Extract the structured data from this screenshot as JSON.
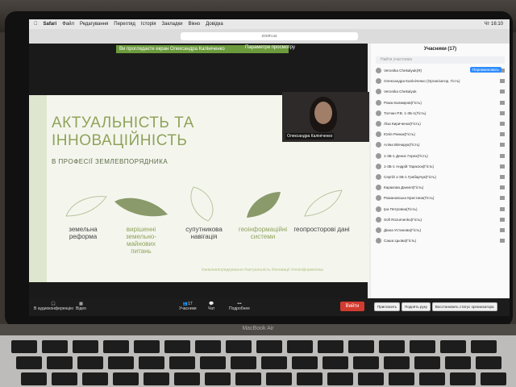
{
  "menubar": {
    "apple": "",
    "app": "Safari",
    "items": [
      "Файл",
      "Редагування",
      "Перегляд",
      "Історія",
      "Закладки",
      "Вікно",
      "Довідка"
    ],
    "clock": "Чт 16:10"
  },
  "browser": {
    "url": "zoom.us"
  },
  "zoom": {
    "share_banner": "Ви проглядаєте екран Олександра Калініченко",
    "view_option": "Параметри просмотру",
    "speaker_name": "Олександра Калініченко",
    "controls": {
      "audio": "В аудиоконференцію",
      "video": "Відео",
      "participants": "Учасники",
      "participants_count": "17",
      "chat": "Чат",
      "more": "Подробнее",
      "leave": "Вийти"
    }
  },
  "slide": {
    "title_line1": "АКТУАЛЬНІСТЬ ТА",
    "title_line2": "ІННОВАЦІЙНІСТЬ",
    "subtitle": "В ПРОФЕСІЇ ЗЕМЛЕВПОРЯДНИКА",
    "captions": [
      {
        "text": "земельна реформа",
        "color": "plain"
      },
      {
        "text": "вирішенні земельно-майнових питань",
        "color": "green"
      },
      {
        "text": "супутникова навігація",
        "color": "plain"
      },
      {
        "text": "геоінформаційні системи",
        "color": "green"
      },
      {
        "text": "геопросторові дані",
        "color": "plain"
      }
    ],
    "hashtags": "#землевпорядкування #актуальність #інновації #геоінформатика"
  },
  "participants": {
    "title": "Учасники (17)",
    "search_placeholder": "Найти участника",
    "rename_label": "Переименовать",
    "list": [
      "Veronika Chekalyuk(Я)",
      "Олександра Калініченко (Організатор, Гість)",
      "Veronika Chekalyuk",
      "Рома Калмиров(Гість)",
      "Толчан Р.В. 1-3Б-1(Гість)",
      "Ліза Кириченко(Гість)",
      "Юлія Ринюк(Гість)",
      "Аліна Вівчарук(Гість)",
      "1-3Б-1 Денис Горех(Гість)",
      "1-3Б-1 Андрій Тарасюк(Гість)",
      "Сергій 1-3Б-1 Грабарчук(Гість)",
      "Каракова Даниїл(Гість)",
      "Романовська Кристина(Гість)",
      "Іра Петровна(Гість)",
      "Sofi Rozumenko(Гість)",
      "Діана Устинова(Гість)",
      "Саша Цьова(Гість)"
    ],
    "buttons": [
      "Пригласить",
      "Поднять руку",
      "Восстановить статус организатора"
    ]
  },
  "laptop": {
    "brand": "MacBook Air"
  },
  "colors": {
    "accent_green": "#8fa35a",
    "leave_red": "#d23b2f",
    "zoom_blue": "#2d8cff"
  }
}
